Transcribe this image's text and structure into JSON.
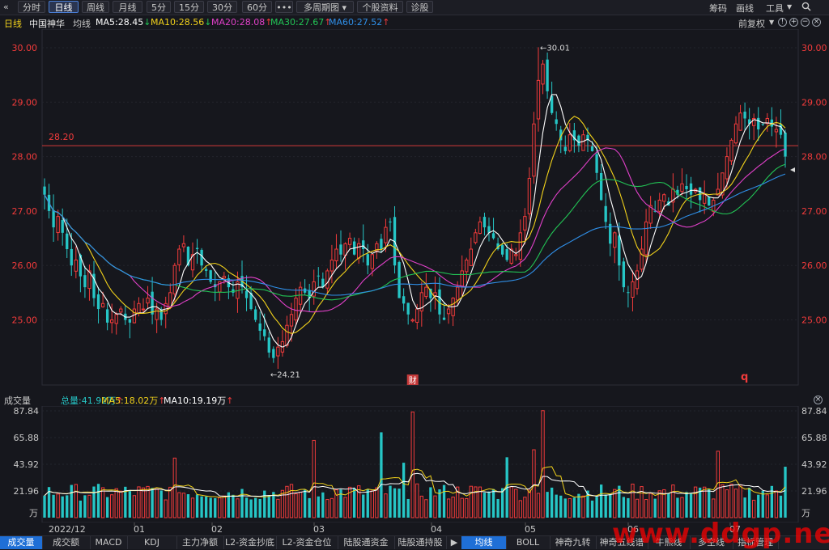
{
  "toolbar": {
    "collapse_icon": "double-chevron-left-icon",
    "buttons": [
      "分时",
      "日线",
      "周线",
      "月线",
      "5分",
      "15分",
      "30分",
      "60分",
      "•••",
      "多周期图",
      "个股资料",
      "诊股"
    ],
    "active": "日线",
    "right_items": [
      "筹码",
      "画线",
      "工具"
    ],
    "right_icons": [
      "dropdown-icon",
      "search-icon"
    ]
  },
  "ma_bar": {
    "period": "日线",
    "stock": "中国神华",
    "mode": "均线",
    "ma5": "MA5:28.45",
    "ma10": "MA10:28.56",
    "ma20": "MA20:28.08",
    "ma30": "MA30:27.67",
    "ma60": "MA60:27.52",
    "ma5_arrow": "↓",
    "ma10_arrow": "↓",
    "ma20_arrow": "↑",
    "ma30_arrow": "↑",
    "ma60_arrow": "↑",
    "adjust": "前复权",
    "adjust_icon": "dropdown-icon",
    "panel_icons": [
      "info-icon",
      "zoom-in-icon",
      "zoom-out-icon",
      "close-icon"
    ]
  },
  "price_chart": {
    "y_ticks": [
      "30.00",
      "29.00",
      "28.00",
      "27.00",
      "26.00",
      "25.00"
    ],
    "ref_line": "28.20",
    "high_label": "←30.01",
    "low_label": "←24.21",
    "fin_badge": "财",
    "q_marker": "q"
  },
  "volume": {
    "title": "成交量",
    "total": "总量:41.92万",
    "total_arrow": "↑",
    "ma5": "MA5:18.02万",
    "ma5_arrow": "↑",
    "ma10": "MA10:19.19万",
    "ma10_arrow": "↑",
    "y_ticks": [
      "87.84",
      "65.88",
      "43.92",
      "21.96"
    ],
    "unit": "万",
    "close_icon": "close-icon"
  },
  "x_axis": [
    "2022/12",
    "01",
    "02",
    "03",
    "04",
    "05",
    "06",
    "07"
  ],
  "tabs_left": [
    "成交量",
    "成交额",
    "MACD",
    "KDJ",
    "主力净额",
    "L2-资金抄底",
    "L2-资金仓位",
    "陆股通资金",
    "陆股通持股"
  ],
  "tabs_right": [
    "均线",
    "BOLL",
    "神奇九转",
    "神奇五线谱",
    "牛熊线",
    "多空线",
    "指标管理"
  ],
  "watermark": "www.ddgp.net",
  "colors": {
    "up": "#f23b3b",
    "down": "#26c6c6",
    "ma5": "#ffffff",
    "ma10": "#f2d21b",
    "ma20": "#e040c8",
    "ma30": "#22c455",
    "ma60": "#2f8fe8",
    "accent": "#1f6fd6"
  },
  "chart_data": {
    "type": "candlestick",
    "title": "",
    "x_range": [
      "2022/12",
      "07"
    ],
    "y_range": [
      24.21,
      30.01
    ],
    "volume_max": 87.84,
    "series": [
      {
        "name": "MA5",
        "values": [
          28.45
        ]
      },
      {
        "name": "MA10",
        "values": [
          28.56
        ]
      },
      {
        "name": "MA20",
        "values": [
          28.08
        ]
      },
      {
        "name": "MA30",
        "values": [
          27.67
        ]
      },
      {
        "name": "MA60",
        "values": [
          27.52
        ]
      }
    ],
    "closes": [
      27.3,
      27.0,
      26.7,
      26.9,
      26.6,
      26.3,
      26.0,
      26.1,
      25.8,
      25.6,
      25.9,
      25.4,
      25.2,
      25.3,
      24.95,
      25.0,
      25.1,
      25.2,
      25.0,
      24.95,
      25.2,
      25.3,
      25.2,
      25.4,
      25.1,
      25.2,
      25.0,
      25.3,
      25.5,
      26.0,
      26.3,
      26.4,
      26.0,
      26.2,
      26.3,
      26.0,
      25.9,
      25.7,
      25.6,
      25.7,
      25.8,
      25.6,
      25.5,
      25.7,
      25.6,
      25.4,
      25.2,
      25.0,
      24.8,
      24.7,
      24.4,
      24.3,
      24.5,
      24.6,
      24.9,
      25.1,
      25.4,
      25.6,
      25.5,
      25.4,
      25.7,
      25.8,
      25.6,
      25.9,
      26.1,
      26.3,
      26.2,
      26.4,
      26.5,
      26.2,
      26.4,
      26.3,
      26.0,
      26.2,
      26.4,
      26.3,
      26.7,
      26.8,
      26.0,
      25.4,
      25.3,
      25.1,
      25.0,
      25.2,
      25.5,
      25.6,
      25.4,
      25.5,
      25.1,
      25.0,
      25.2,
      25.4,
      25.6,
      25.9,
      26.1,
      26.3,
      26.6,
      26.8,
      26.7,
      26.6,
      26.5,
      26.3,
      26.2,
      26.1,
      26.3,
      26.2,
      26.6,
      26.9,
      27.6,
      28.6,
      29.4,
      29.7,
      29.2,
      28.8,
      28.6,
      28.3,
      28.1,
      28.4,
      28.3,
      28.2,
      28.4,
      28.3,
      28.1,
      27.7,
      27.2,
      26.8,
      26.4,
      26.6,
      26.0,
      25.6,
      25.5,
      25.7,
      25.9,
      26.3,
      26.8,
      27.1,
      27.0,
      27.2,
      27.3,
      27.1,
      27.4,
      27.3,
      27.5,
      27.4,
      27.3,
      27.4,
      27.2,
      27.3,
      27.1,
      27.2,
      27.4,
      27.7,
      28.0,
      28.3,
      28.6,
      28.8,
      28.7,
      28.6,
      28.7,
      28.5,
      28.6,
      28.7,
      28.55,
      28.5,
      28.4,
      28.0
    ]
  }
}
